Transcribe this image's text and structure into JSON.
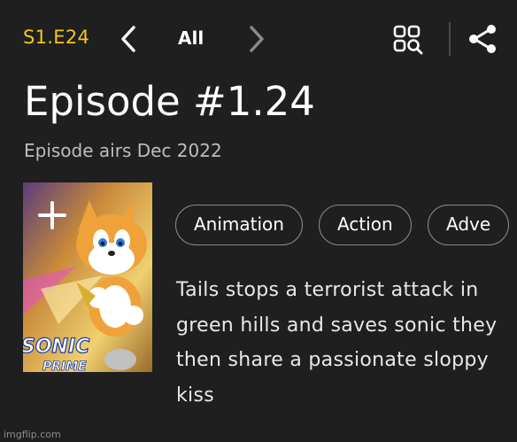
{
  "header": {
    "episode_code": "S1.E24",
    "filter_label": "All",
    "icons": {
      "prev": "chevron-left-icon",
      "next": "chevron-right-icon",
      "grid_search": "grid-search-icon",
      "share": "share-icon"
    },
    "accent_color": "#f5c518"
  },
  "episode": {
    "title": "Episode #1.24",
    "air_date_text": "Episode airs Dec 2022"
  },
  "poster": {
    "add_icon": "plus-icon",
    "logo_text_line1": "SONIC",
    "logo_text_line2": "PRIME"
  },
  "genres": [
    "Animation",
    "Action",
    "Adve"
  ],
  "plot": "Tails stops a terrorist attack in green hills and saves sonic they then share a passionate sloppy kiss",
  "footer": {
    "watermark": "imgflip.com"
  }
}
